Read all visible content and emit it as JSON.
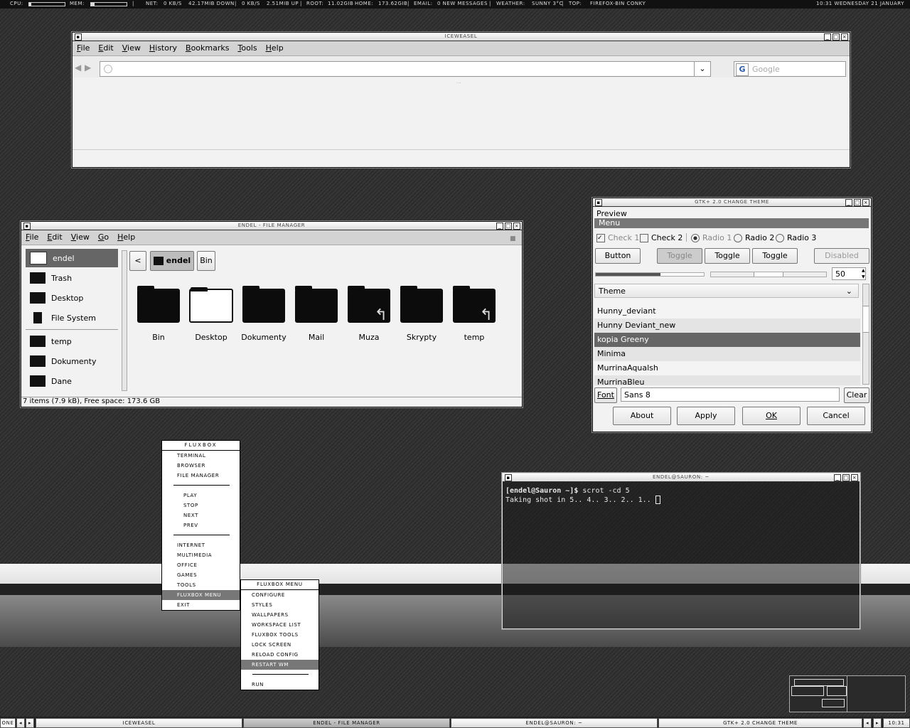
{
  "conky": {
    "cpu_label": "CPU:",
    "cpu_level": 0.05,
    "mem_label": "MEM:",
    "mem_level": 0.1,
    "net": "NET:",
    "down_rate": "0 KB/S",
    "down_total": "42.17MiB Down",
    "up_rate": "0 KB/S",
    "up_total": "2.51MiB Up",
    "root_label": "ROOT:",
    "root_free": "11.02GiB",
    "home_label": "HOME:",
    "home_free": "173.62GiB",
    "email_label": "EMAIL:",
    "email_value": "0 New Messages",
    "weather_label": "WEATHER:",
    "weather_value": "Sunny 3°C",
    "top_label": "TOP:",
    "top_value": "firefox-bin  conky",
    "clock": "10:31 Wednesday 21 January"
  },
  "browser": {
    "title": "ICEWEASEL",
    "menu": [
      "File",
      "Edit",
      "View",
      "History",
      "Bookmarks",
      "Tools",
      "Help"
    ],
    "url_value": "",
    "search_placeholder": "Google",
    "search_engine_letter": "G"
  },
  "file_manager": {
    "title": "ENDEL - FILE MANAGER",
    "menu": [
      "File",
      "Edit",
      "View",
      "Go",
      "Help"
    ],
    "sidebar": [
      {
        "label": "endel",
        "icon": "home-icon",
        "selected": true
      },
      {
        "label": "Trash",
        "icon": "trash-icon"
      },
      {
        "label": "Desktop",
        "icon": "desktop-icon"
      },
      {
        "label": "File System",
        "icon": "drive-icon"
      },
      {
        "label": "temp",
        "icon": "folder-icon"
      },
      {
        "label": "Dokumenty",
        "icon": "folder-icon"
      },
      {
        "label": "Dane",
        "icon": "folder-icon"
      }
    ],
    "path": [
      "endel",
      "Bin"
    ],
    "back_glyph": "<",
    "items": [
      {
        "label": "Bin",
        "icon": "folder-icon"
      },
      {
        "label": "Desktop",
        "icon": "desktop-folder-icon"
      },
      {
        "label": "Dokumenty",
        "icon": "folder-icon"
      },
      {
        "label": "Mail",
        "icon": "folder-icon"
      },
      {
        "label": "Muza",
        "icon": "folder-link-icon"
      },
      {
        "label": "Skrypty",
        "icon": "folder-icon"
      },
      {
        "label": "temp",
        "icon": "folder-link-icon"
      }
    ],
    "status": "7 items (7.9 kB), Free space: 173.6 GB"
  },
  "gtk": {
    "title": "GTK+ 2.0 CHANGE THEME",
    "preview_label": "Preview",
    "menu_label": "Menu",
    "check1": "Check 1",
    "check2": "Check 2",
    "radio1": "Radio 1",
    "radio2": "Radio 2",
    "radio3": "Radio 3",
    "button": "Button",
    "toggle1": "Toggle",
    "toggle2": "Toggle",
    "toggle3": "Toggle",
    "disabled": "Disabled",
    "progress": 0.6,
    "spin_value": "50",
    "theme_header": "Theme",
    "themes": [
      "Hunny_deviant",
      "Hunny Deviant_new",
      "kopia Greeny",
      "Minima",
      "MurrinaAqualsh",
      "MurrinaBleu"
    ],
    "selected_theme": "kopia Greeny",
    "font_label": "Font",
    "font_value": "Sans 8",
    "clear": "Clear",
    "about": "About",
    "apply": "Apply",
    "ok": "OK",
    "cancel": "Cancel"
  },
  "terminal": {
    "title": "ENDEL@SAURON: ~",
    "prompt": "[endel@Sauron ~]$",
    "command": " scrot -cd 5",
    "output": "Taking shot in 5.. 4.. 3.. 2.. 1.. "
  },
  "fluxbox_menu": {
    "title": "FLUXBOX",
    "items_a": [
      "Terminal",
      "Browser",
      "File Manager"
    ],
    "items_b": [
      "Play",
      "Stop",
      "Next",
      "Prev"
    ],
    "items_c": [
      "Internet",
      "Multimedia",
      "Office",
      "Games",
      "Tools",
      "Fluxbox menu",
      "Exit"
    ],
    "selected": "Fluxbox menu"
  },
  "fluxbox_submenu": {
    "title": "Fluxbox menu",
    "items": [
      "Configure",
      "Styles",
      "Wallpapers",
      "Workspace List",
      "Fluxbox tools",
      "Lock screen",
      "Reload config",
      "Restart WM"
    ],
    "selected": "Restart WM",
    "run": "Run"
  },
  "taskbar": {
    "workspace": "ONE",
    "tasks": [
      "ICEWEASEL",
      "ENDEL - FILE MANAGER",
      "ENDEL@SAURON: ~",
      "GTK+ 2.0 CHANGE THEME"
    ],
    "active_task": "ENDEL - FILE MANAGER",
    "clock": "10:31"
  }
}
